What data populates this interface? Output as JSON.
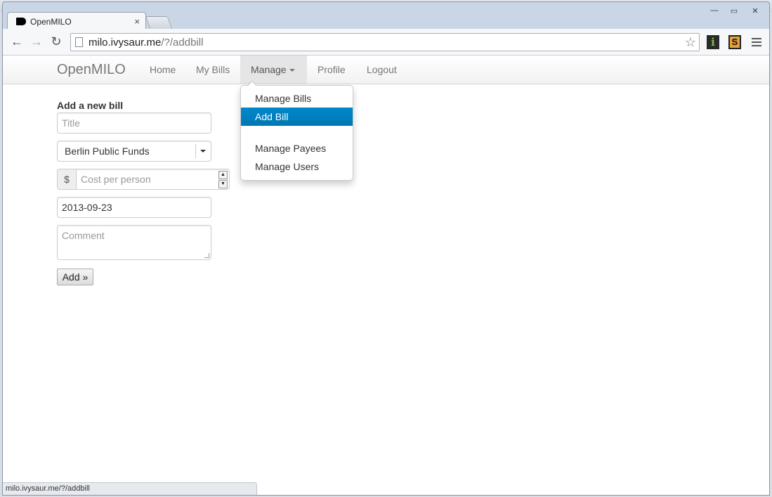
{
  "browser": {
    "tab_title": "OpenMILO",
    "tab_close": "×",
    "url_host": "milo.ivysaur.me",
    "url_path": "/?/addbill",
    "status_url": "milo.ivysaur.me/?/addbill",
    "ext_info_label": "i",
    "ext_sync_label": "S",
    "window_minimize": "—",
    "window_maximize": "▭",
    "window_close": "✕"
  },
  "navbar": {
    "brand": "OpenMILO",
    "items": [
      {
        "label": "Home"
      },
      {
        "label": "My Bills"
      },
      {
        "label": "Manage"
      },
      {
        "label": "Profile"
      },
      {
        "label": "Logout"
      }
    ]
  },
  "dropdown": {
    "items": [
      {
        "label": "Manage Bills"
      },
      {
        "label": "Add Bill"
      },
      {
        "label": "Manage Payees"
      },
      {
        "label": "Manage Users"
      }
    ],
    "selected": "Add Bill"
  },
  "form": {
    "legend": "Add a new bill",
    "title_placeholder": "Title",
    "payee_selected": "Berlin Public Funds",
    "currency_symbol": "$",
    "cost_placeholder": "Cost per person",
    "date_value": "2013-09-23",
    "comment_placeholder": "Comment",
    "submit_label": "Add »"
  },
  "icons": [
    "back-arrow-icon",
    "forward-arrow-icon",
    "reload-icon",
    "page-icon",
    "star-icon",
    "menu-icon"
  ]
}
